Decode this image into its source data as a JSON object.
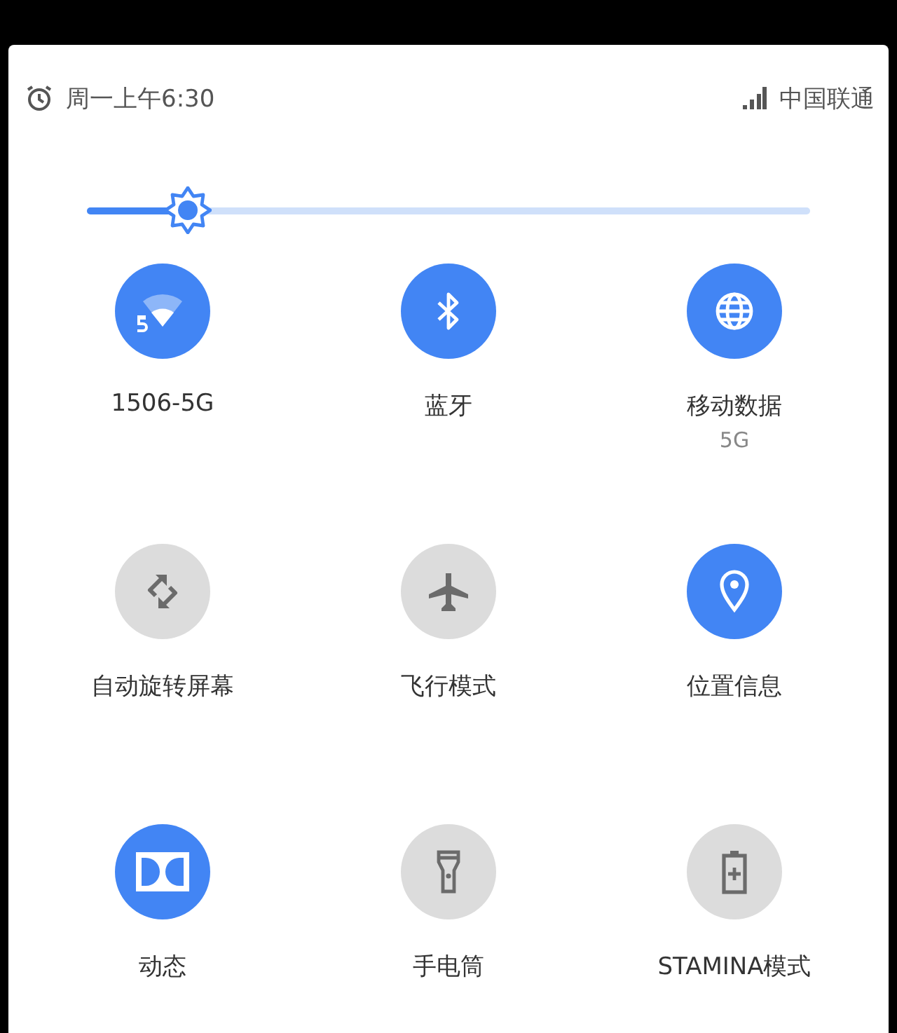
{
  "header": {
    "alarm_time": "周一上午6:30",
    "carrier": "中国联通"
  },
  "brightness": {
    "level": 0.14
  },
  "tiles": [
    {
      "label": "1506-5G",
      "on": true
    },
    {
      "label": "蓝牙",
      "on": true
    },
    {
      "label": "移动数据",
      "sublabel": "5G",
      "on": true
    },
    {
      "label": "自动旋转屏幕",
      "on": false
    },
    {
      "label": "飞行模式",
      "on": false
    },
    {
      "label": "位置信息",
      "on": true
    },
    {
      "label": "动态",
      "on": true
    },
    {
      "label": "手电筒",
      "on": false
    },
    {
      "label": "STAMINA模式",
      "on": false
    }
  ]
}
